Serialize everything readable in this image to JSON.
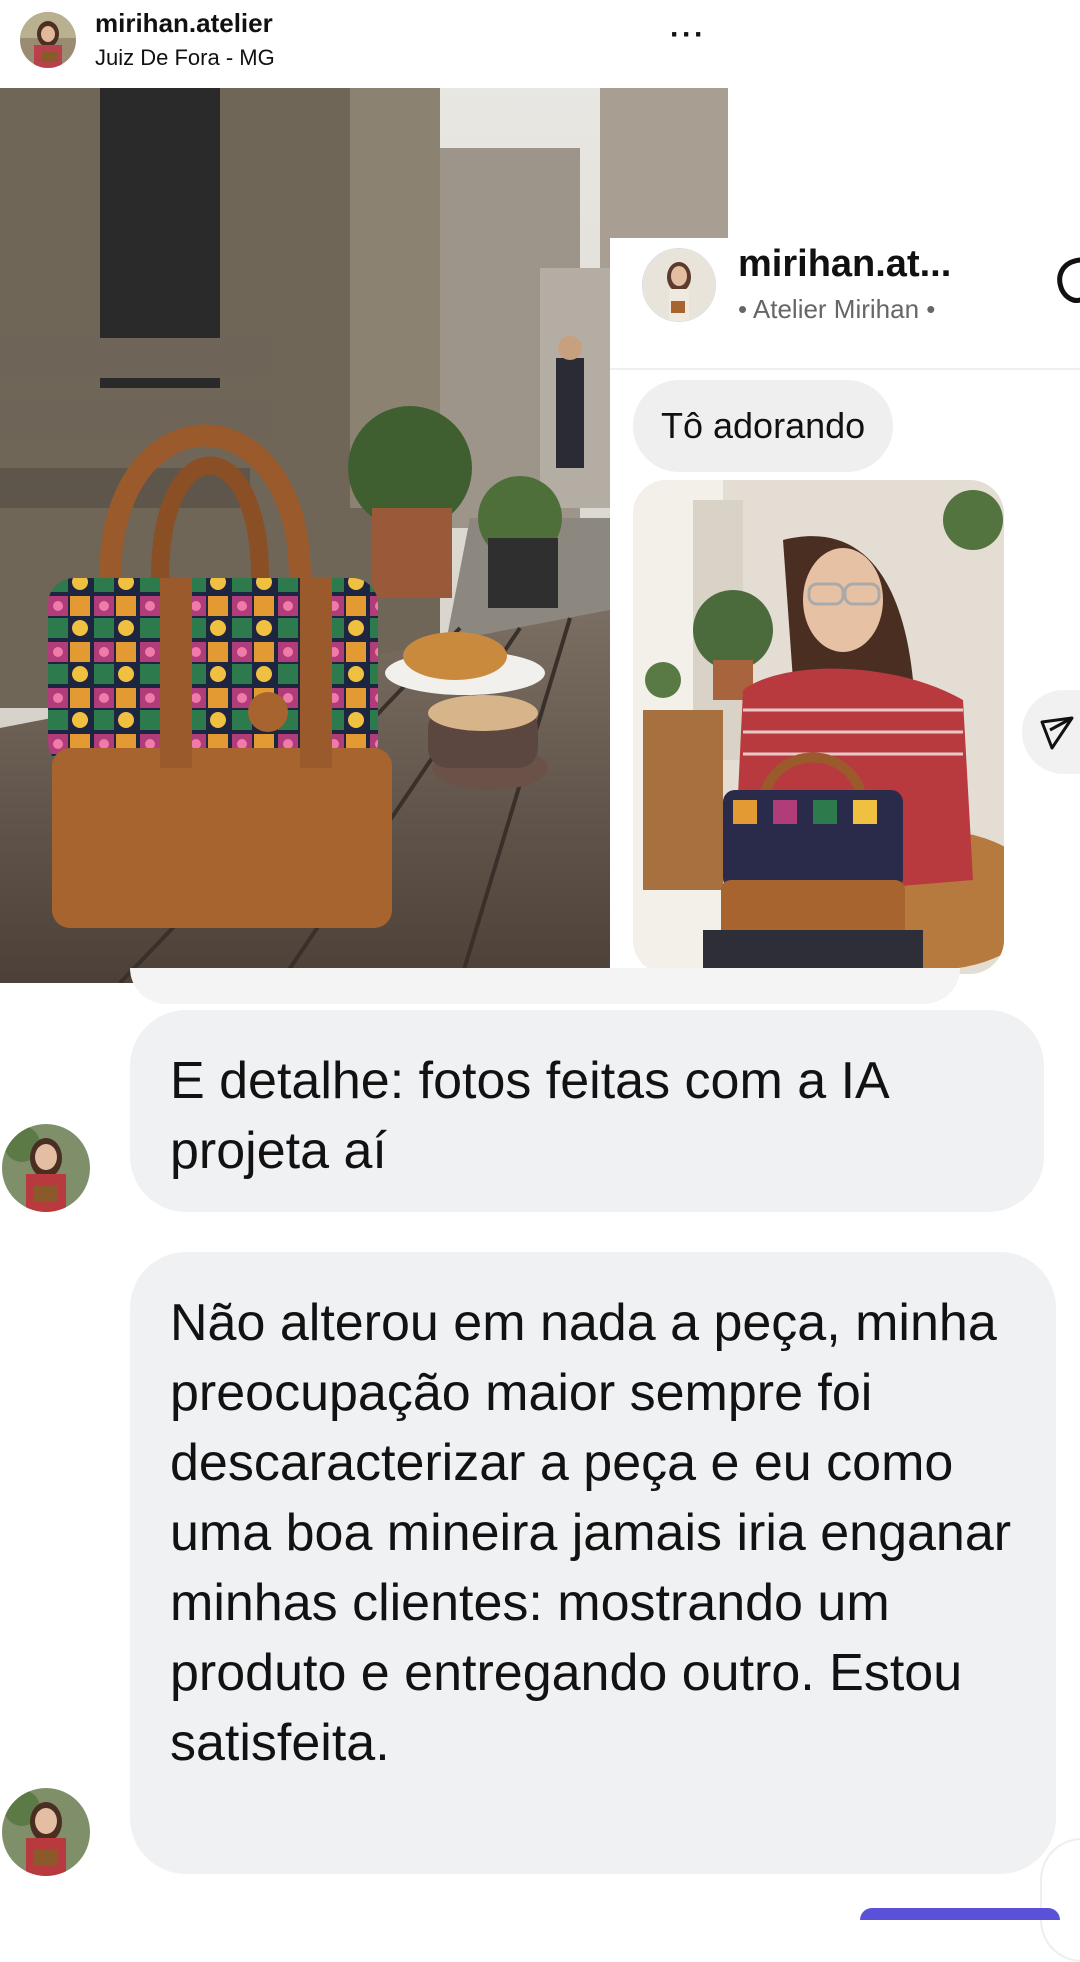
{
  "post": {
    "username": "mirihan.atelier",
    "location": "Juiz De Fora - MG",
    "more_label": "···"
  },
  "dm": {
    "username": "mirihan.at...",
    "subtitle": "• Atelier Mirihan •",
    "message_short": "Tô adorando"
  },
  "chat": {
    "message_1": "E detalhe: fotos feitas com a IA projeta aí",
    "message_2": "Não alterou em nada a peça, minha preocupação maior sempre foi descaracterizar a peça e eu como uma boa mineira jamais iria enganar minhas clientes: mostrando um produto e entregando outro. Estou satisfeita."
  },
  "icons": [
    "more-icon",
    "phone-icon",
    "send-icon"
  ],
  "colors": {
    "bubble_bg": "#f0f1f3",
    "accent_purple": "#5b51d8",
    "text": "#121212"
  }
}
